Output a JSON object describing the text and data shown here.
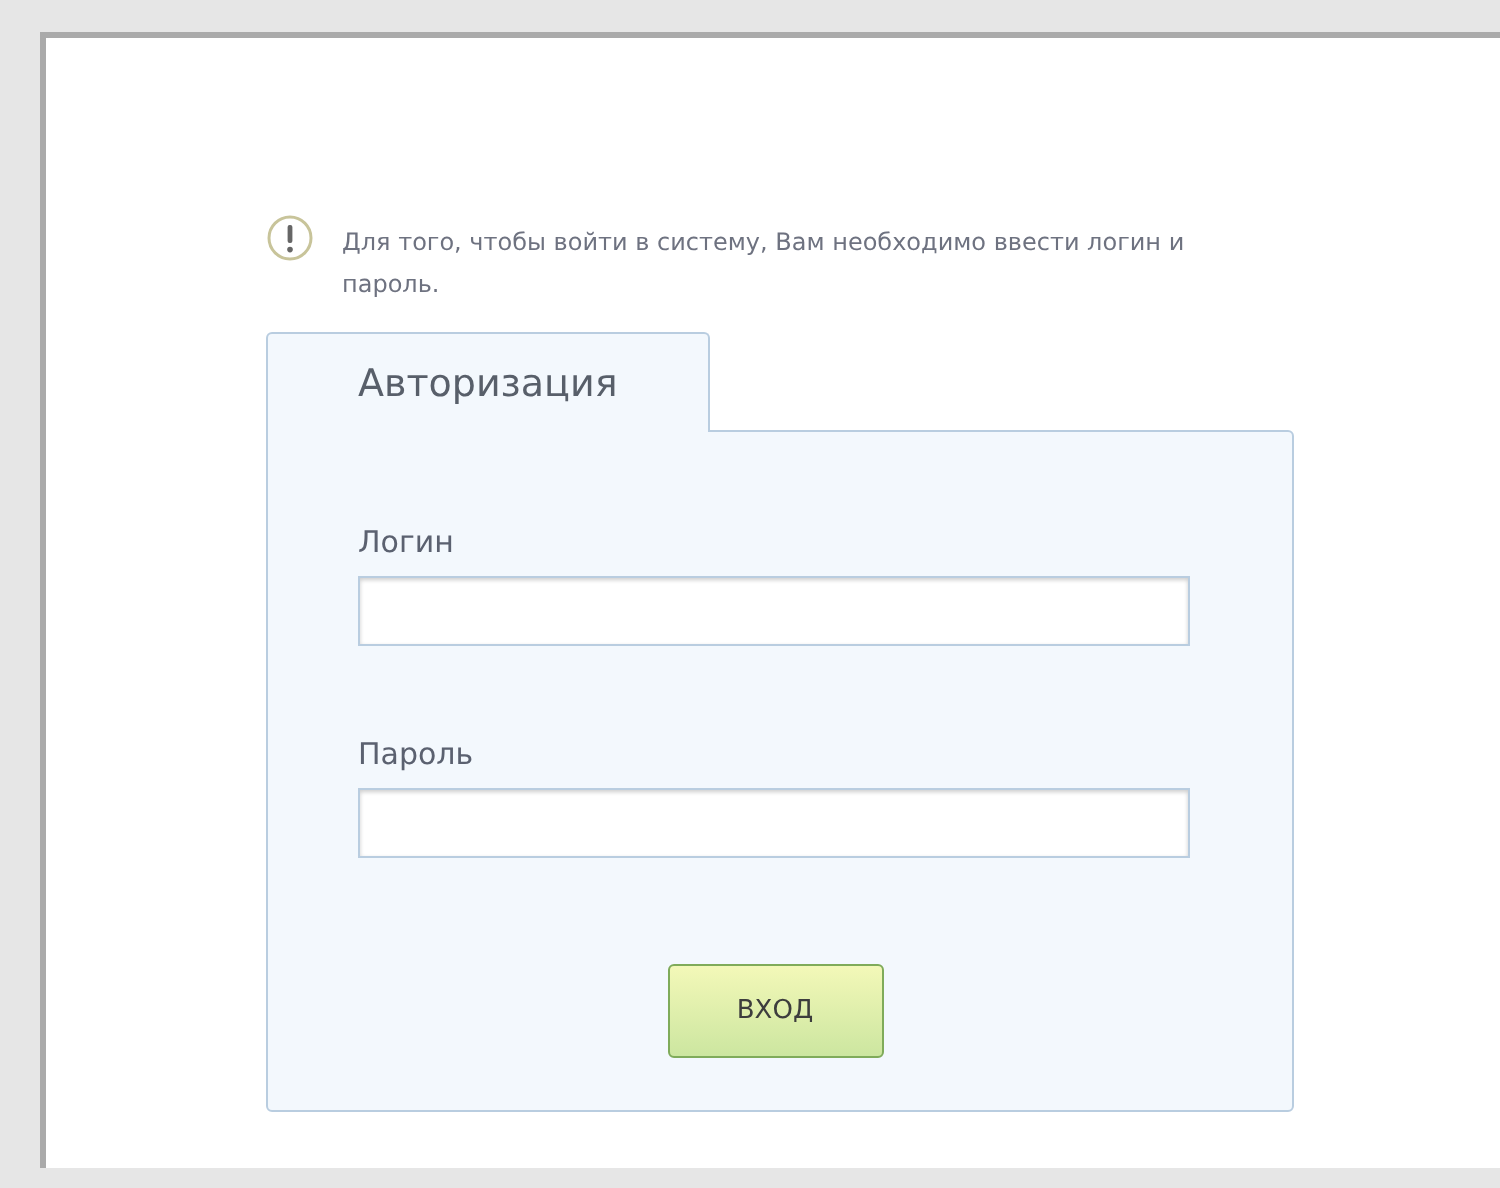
{
  "notice": {
    "text": "Для того, чтобы войти в систему, Вам необходимо ввести логин и пароль."
  },
  "tab": {
    "label": "Авторизация"
  },
  "fields": [
    {
      "label": "Логин"
    },
    {
      "label": "Пароль"
    }
  ],
  "submit": {
    "label": "ВХОД"
  }
}
